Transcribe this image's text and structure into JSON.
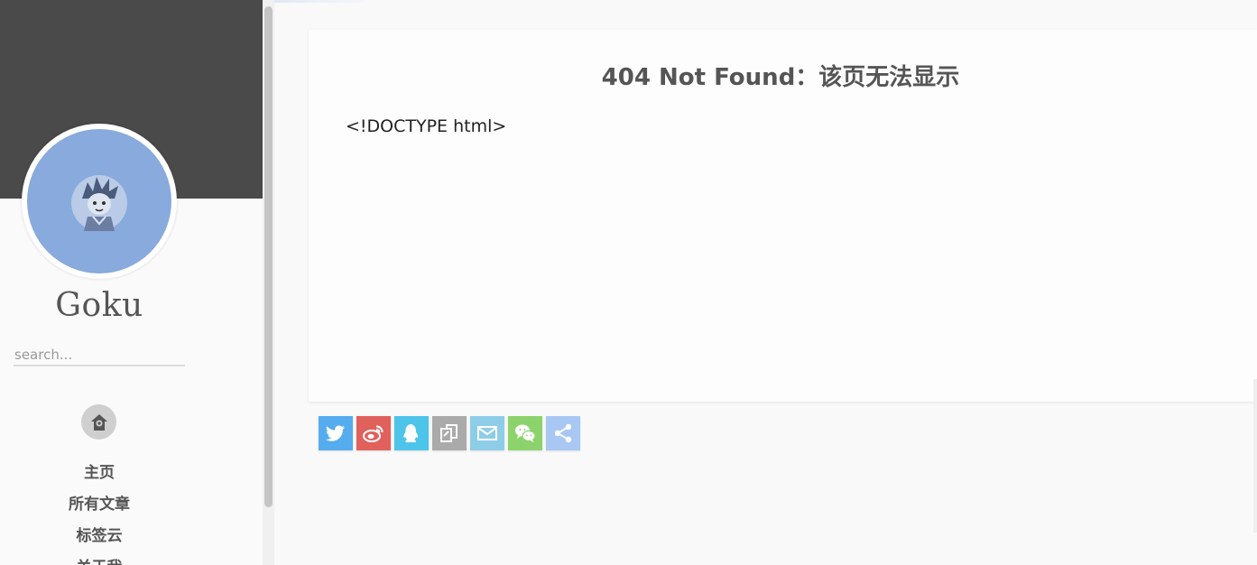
{
  "sidebar": {
    "site_name": "Goku",
    "search_placeholder": "search...",
    "avatar_icon": "goku-avatar",
    "home_icon": "home-icon",
    "nav": [
      {
        "label": "主页"
      },
      {
        "label": "所有文章"
      },
      {
        "label": "标签云"
      },
      {
        "label": "关于我"
      }
    ]
  },
  "main": {
    "title": "404 Not Found：该页无法显示",
    "body_text": "<!DOCTYPE html>"
  },
  "share": [
    {
      "name": "twitter",
      "icon": "twitter-icon",
      "color": "#55acee"
    },
    {
      "name": "weibo",
      "icon": "weibo-icon",
      "color": "#e0605c"
    },
    {
      "name": "qq",
      "icon": "qq-icon",
      "color": "#4dc4ea"
    },
    {
      "name": "copy",
      "icon": "copy-icon",
      "color": "#aaaaaa"
    },
    {
      "name": "email",
      "icon": "email-icon",
      "color": "#8ecde8"
    },
    {
      "name": "wechat",
      "icon": "wechat-icon",
      "color": "#8dd36d"
    },
    {
      "name": "more",
      "icon": "share-icon",
      "color": "#a8c8f3"
    }
  ],
  "colors": {
    "sidebar_header": "#4a4a4a",
    "avatar_bg": "#88aadc",
    "text": "#555555"
  }
}
